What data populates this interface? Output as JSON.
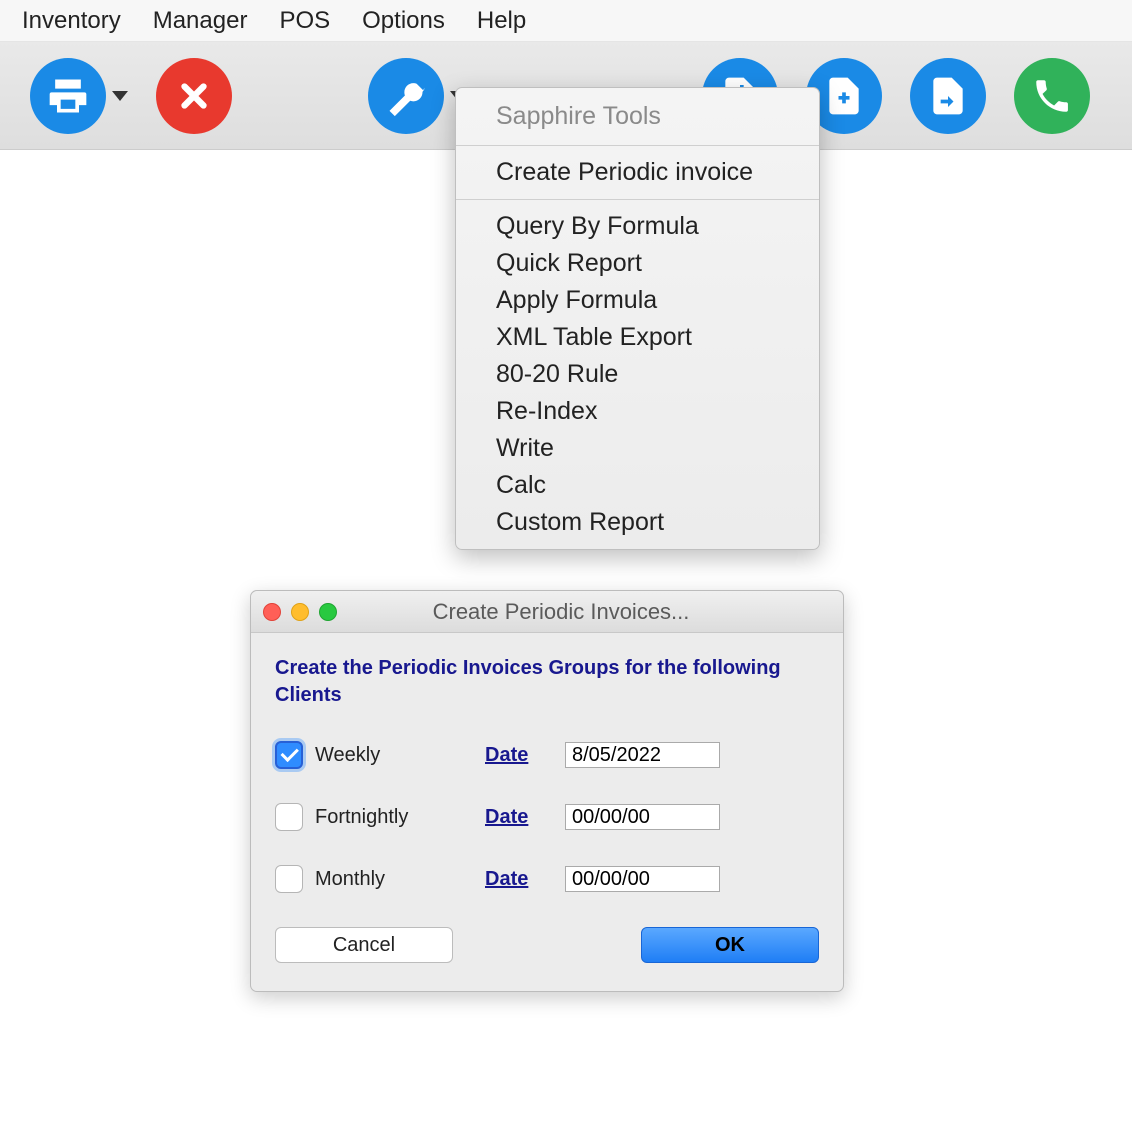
{
  "menubar": {
    "items": [
      "Inventory",
      "Manager",
      "POS",
      "Options",
      "Help"
    ]
  },
  "toolbar": {
    "print_icon": "print",
    "close_icon": "close",
    "tools_icon": "wrench",
    "doc_in_icon": "doc-in",
    "doc_add_icon": "doc-add",
    "doc_out_icon": "doc-out",
    "phone_icon": "phone"
  },
  "dropdown": {
    "header": "Sapphire Tools",
    "sections": [
      [
        "Create Periodic invoice"
      ],
      [
        "Query By Formula",
        "Quick Report",
        "Apply Formula",
        "XML Table Export",
        "80-20 Rule",
        "Re-Index",
        "Write",
        "Calc",
        "Custom Report"
      ]
    ]
  },
  "dialog": {
    "title": "Create Periodic Invoices...",
    "heading": "Create the Periodic Invoices Groups for the following Clients",
    "options": [
      {
        "label": "Weekly",
        "checked": true,
        "date_label": "Date",
        "value": "8/05/2022"
      },
      {
        "label": "Fortnightly",
        "checked": false,
        "date_label": "Date",
        "value": "00/00/00"
      },
      {
        "label": "Monthly",
        "checked": false,
        "date_label": "Date",
        "value": "00/00/00"
      }
    ],
    "cancel_label": "Cancel",
    "ok_label": "OK"
  }
}
